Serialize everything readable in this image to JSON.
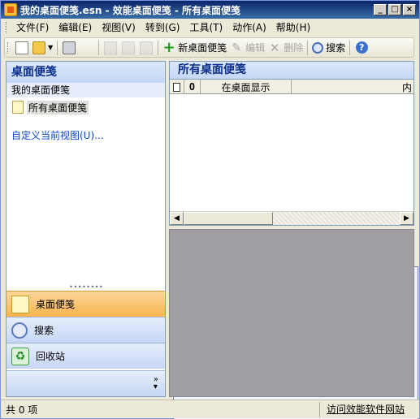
{
  "window": {
    "title": "我的桌面便笺.esn - 效能桌面便笺 - 所有桌面便笺",
    "controls": [
      "_",
      "□",
      "×"
    ]
  },
  "menu": [
    "文件(F)",
    "编辑(E)",
    "视图(V)",
    "转到(G)",
    "工具(T)",
    "动作(A)",
    "帮助(H)"
  ],
  "toolbar": {
    "new_note": "新桌面便笺",
    "edit": "编辑",
    "delete": "删除",
    "search": "搜索"
  },
  "left_pane": {
    "header": "桌面便笺",
    "section_title": "我的桌面便笺",
    "folder": "所有桌面便笺",
    "customize_view": "自定义当前视图(U)...",
    "nav": [
      {
        "label": "桌面便笺",
        "icon": "notes-icon",
        "active": true
      },
      {
        "label": "搜索",
        "icon": "search-icon",
        "active": false
      },
      {
        "label": "回收站",
        "icon": "recycle-bin-icon",
        "active": false
      }
    ]
  },
  "right_pane": {
    "header": "所有桌面便笺",
    "columns": [
      "",
      "",
      "在桌面显示",
      "内"
    ]
  },
  "statusbar": {
    "count": "共 0 项",
    "link": "访问效能软件网站"
  },
  "colors": {
    "title_bar": "#0a246a",
    "pane_header_text": "#0b2e8a",
    "active_nav": "#f8b44c",
    "preview_bg": "#a19fa4"
  }
}
